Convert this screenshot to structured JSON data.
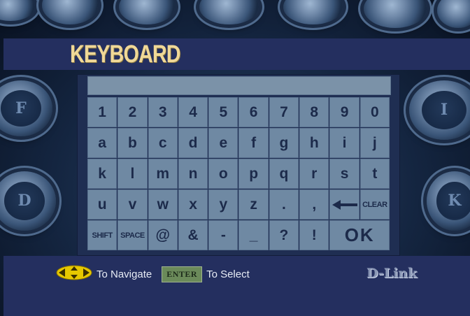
{
  "title": "KEYBOARD",
  "text_field_value": "",
  "rows": [
    [
      "1",
      "2",
      "3",
      "4",
      "5",
      "6",
      "7",
      "8",
      "9",
      "0"
    ],
    [
      "a",
      "b",
      "c",
      "d",
      "e",
      "f",
      "g",
      "h",
      "i",
      "j"
    ],
    [
      "k",
      "l",
      "m",
      "n",
      "o",
      "p",
      "q",
      "r",
      "s",
      "t"
    ],
    [
      "u",
      "v",
      "w",
      "x",
      "y",
      "z",
      ".",
      ",",
      "←",
      "CLEAR"
    ],
    [
      "SHIFT",
      "SPACE",
      "@",
      "&",
      "-",
      "_",
      "?",
      "!",
      "OK"
    ]
  ],
  "footer": {
    "navigate_text": "To Navigate",
    "enter_label": "ENTER",
    "select_text": "To Select",
    "brand": "D-Link"
  },
  "background_key_letters": [
    "D",
    "K",
    "F",
    "I"
  ],
  "colors": {
    "title": "#f0d897",
    "key_bg": "#6f89a3",
    "key_text": "#1c2a4a",
    "band": "#242f5f",
    "enter_badge": "#6b8a5a",
    "nav_icon": "#e6c800"
  }
}
